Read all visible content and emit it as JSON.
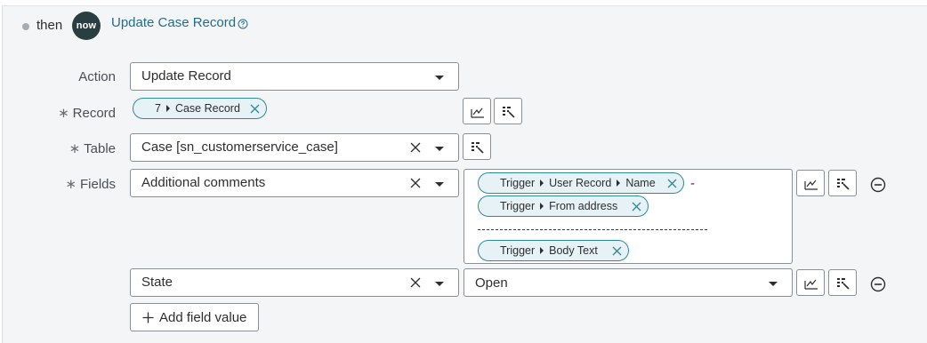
{
  "header": {
    "then_label": "then",
    "logo_text": "now",
    "action_title": "Update Case Record",
    "help_icon": "question-circle-icon"
  },
  "form": {
    "action": {
      "label": "Action",
      "value": "Update Record"
    },
    "record": {
      "label": "Record",
      "required": true,
      "pill": {
        "segments": [
          "7",
          "Case Record"
        ]
      }
    },
    "table": {
      "label": "Table",
      "required": true,
      "value": "Case [sn_customerservice_case]"
    },
    "fields": {
      "label": "Fields",
      "required": true,
      "rows": [
        {
          "field": "Additional comments",
          "value_pills": [
            {
              "segments": [
                "Trigger",
                "User Record",
                "Name"
              ]
            },
            {
              "segments": [
                "Trigger",
                "From address"
              ]
            },
            {
              "segments": [
                "Trigger",
                "Body Text"
              ]
            }
          ],
          "separator_text": "-"
        },
        {
          "field": "State",
          "value": "Open"
        }
      ]
    },
    "add_field_value_label": "Add field value"
  },
  "icons": {
    "data_pill_picker": "data-pill-picker-icon",
    "script_toggle": "script-toggle-icon",
    "remove": "minus-circle-icon",
    "clear": "close-icon",
    "dropdown": "chevron-down-icon"
  },
  "colors": {
    "accent": "#1f6e8c",
    "pill_border": "#2c8a9e",
    "pill_bg": "#e6f2f5",
    "logo_bg": "#293e40",
    "panel_bg": "#f4f5f7"
  }
}
